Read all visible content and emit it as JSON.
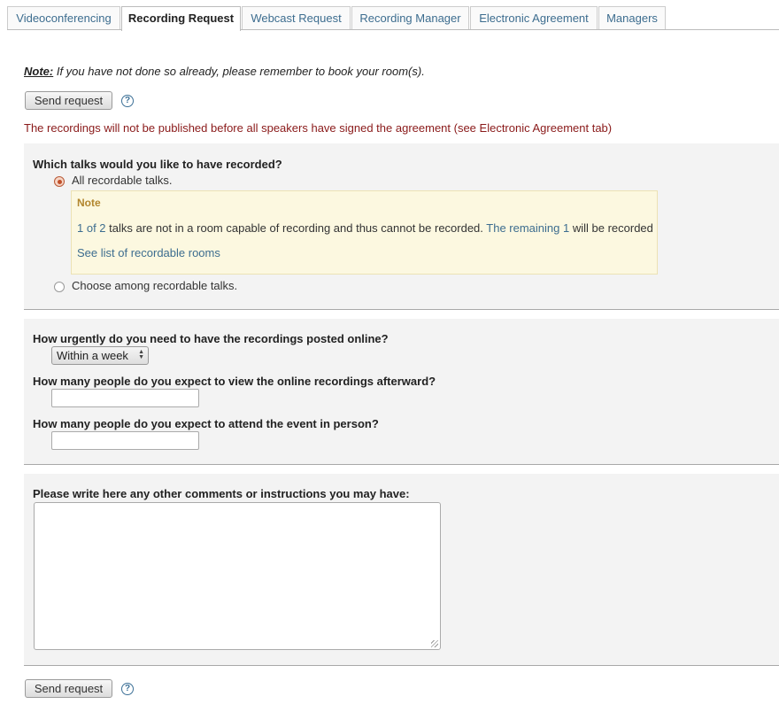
{
  "tabs": [
    {
      "label": "Videoconferencing"
    },
    {
      "label": "Recording Request"
    },
    {
      "label": "Webcast Request"
    },
    {
      "label": "Recording Manager"
    },
    {
      "label": "Electronic Agreement"
    },
    {
      "label": "Managers"
    }
  ],
  "active_tab": "Recording Request",
  "notice": {
    "prefix": "Note:",
    "text": " If you have not done so already, please remember to book your room(s)."
  },
  "send_button_label": "Send request",
  "help_icon_glyph": "?",
  "warning": "The recordings will not be published before all speakers have signed the agreement (see Electronic Agreement tab)",
  "talks_section": {
    "question": "Which talks would you like to have recorded?",
    "option_all": "All recordable talks.",
    "option_choose": "Choose among recordable talks.",
    "selected": "All recordable talks.",
    "note": {
      "title": "Note",
      "count_link": "1 of 2",
      "middle_text": " talks are not in a room capable of recording and thus cannot be recorded. ",
      "remaining_link": "The remaining 1",
      "end_text": " will be recorded",
      "rooms_link": "See list of recordable rooms"
    }
  },
  "details_section": {
    "urgency_question": "How urgently do you need to have the recordings posted online?",
    "urgency_value": "Within a week",
    "viewers_question": "How many people do you expect to view the online recordings afterward?",
    "viewers_value": "",
    "attendance_question": "How many people do you expect to attend the event in person?",
    "attendance_value": ""
  },
  "comments_section": {
    "label": "Please write here any other comments or instructions you may have:",
    "value": ""
  },
  "colors": {
    "link": "#3d6d8f",
    "warning": "#8a1a1a",
    "note_bg": "#fcf8e0",
    "note_title": "#b2862e",
    "radio_selected": "#c0502a",
    "section_bg": "#f3f3f3"
  },
  "icons": {
    "help": "help-circle-icon",
    "select_arrows": "updown-arrows-icon",
    "resize_grip": "resize-grip-icon"
  }
}
